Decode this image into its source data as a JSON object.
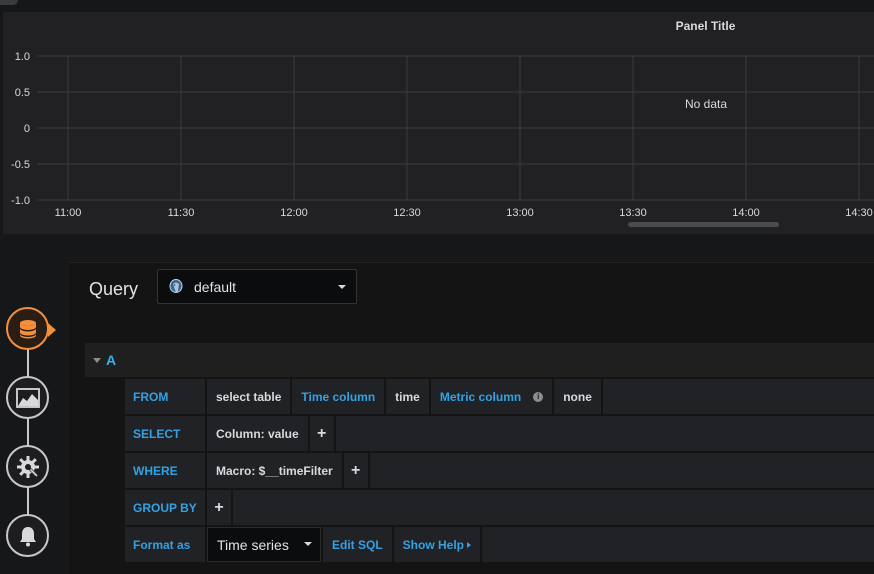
{
  "panel": {
    "title": "Panel Title",
    "no_data_text": "No data",
    "y_ticks": [
      "1.0",
      "0.5",
      "0",
      "-0.5",
      "-1.0"
    ],
    "x_ticks": [
      "11:00",
      "11:30",
      "12:00",
      "12:30",
      "13:00",
      "13:30",
      "14:00",
      "14:30"
    ]
  },
  "editor": {
    "title": "Query",
    "datasource": "default",
    "query": {
      "ref_id": "A",
      "from": {
        "keyword": "FROM",
        "table": "select table",
        "time_label": "Time column",
        "time_value": "time",
        "metric_label": "Metric column",
        "metric_info": "i",
        "metric_value": "none"
      },
      "select": {
        "keyword": "SELECT",
        "value": "Column: value",
        "add": "+"
      },
      "where": {
        "keyword": "WHERE",
        "value": "Macro: $__timeFilter",
        "add": "+"
      },
      "group_by": {
        "keyword": "GROUP BY",
        "add": "+"
      },
      "format": {
        "label": "Format as",
        "value": "Time series",
        "edit_sql": "Edit SQL",
        "show_help": "Show Help"
      }
    }
  },
  "rail": {
    "items": [
      {
        "name": "queries",
        "icon": "database-icon",
        "active": true
      },
      {
        "name": "visualization",
        "icon": "area-chart-icon",
        "active": false
      },
      {
        "name": "general",
        "icon": "gear-icon",
        "active": false
      },
      {
        "name": "alert",
        "icon": "bell-icon",
        "active": false
      }
    ]
  },
  "colors": {
    "accent_blue": "#33a2e5",
    "active_orange": "#f58f3a",
    "panel_bg": "#212124",
    "grid": "#3a3b3e"
  }
}
